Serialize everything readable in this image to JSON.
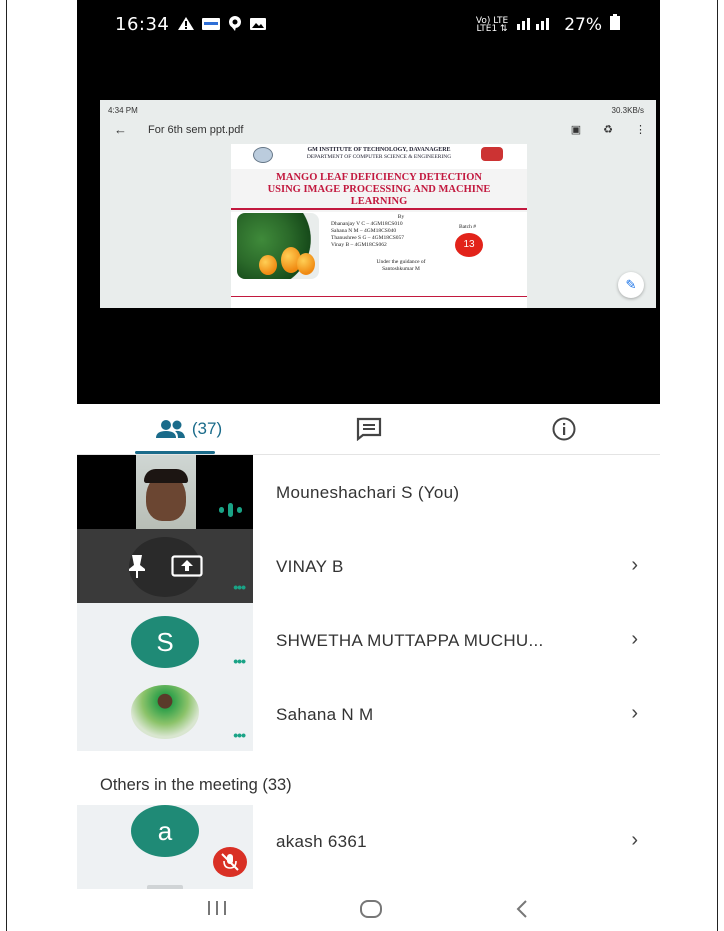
{
  "status_bar": {
    "time": "16:34",
    "network": "LTE",
    "battery": "27%"
  },
  "shared_screen": {
    "mini_status_time": "4:34 PM",
    "mini_status_speed": "30.3KB/s",
    "file_title": "For 6th sem ppt.pdf",
    "slide": {
      "institute": "GM INSTITUTE OF TECHNOLOGY, DAVANAGERE",
      "department": "DEPARTMENT OF COMPUTER SCIENCE & ENGINEERING",
      "title_line1": "MANGO LEAF DEFICIENCY DETECTION",
      "title_line2": "USING IMAGE PROCESSING AND MACHINE",
      "title_line3": "LEARNING",
      "by": "By",
      "members": [
        "Dhananjay V C – 4GM18CS010",
        "Sahana N M – 4GM18CS040",
        "Thanushree S G – 4GM18CS057",
        "Vinay B – 4GM18CS062"
      ],
      "batch_label": "Batch #",
      "batch_number": "13",
      "guidance_1": "Under the guidance of",
      "guidance_2": "Santoshkumar M"
    }
  },
  "tabs": {
    "people_count": "(37)"
  },
  "participants": [
    {
      "name": "Mouneshachari S (You)"
    },
    {
      "name": "VINAY B"
    },
    {
      "name": "SHWETHA MUTTAPPA MUCHU...",
      "initial": "S"
    },
    {
      "name": "Sahana N M"
    }
  ],
  "others": {
    "heading": "Others in the meeting (33)",
    "items": [
      {
        "name": "akash 6361",
        "initial": "a"
      }
    ]
  },
  "colors": {
    "accent": "#1a6b8a",
    "avatar_green": "#1f8a76",
    "mute_red": "#d93025"
  }
}
